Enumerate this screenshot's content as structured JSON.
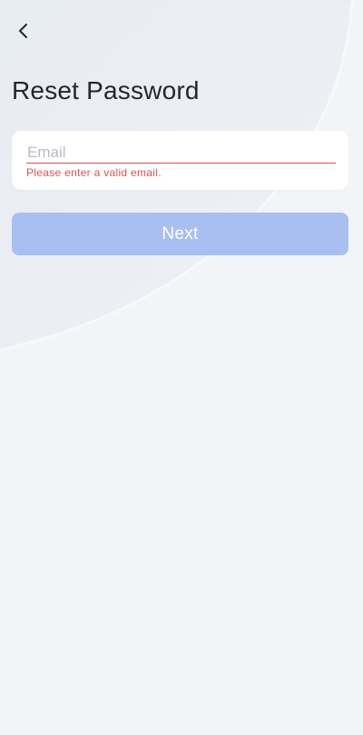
{
  "header": {
    "back_icon": "chevron-left-icon",
    "title": "Reset Password"
  },
  "form": {
    "email_value": "",
    "email_placeholder": "Email",
    "email_error": "Please enter a valid email."
  },
  "actions": {
    "next_label": "Next",
    "next_enabled": false
  },
  "colors": {
    "background": "#f3f4f7",
    "error": "#d9534f",
    "button_disabled": "#a9bff0",
    "title": "#23262b"
  }
}
